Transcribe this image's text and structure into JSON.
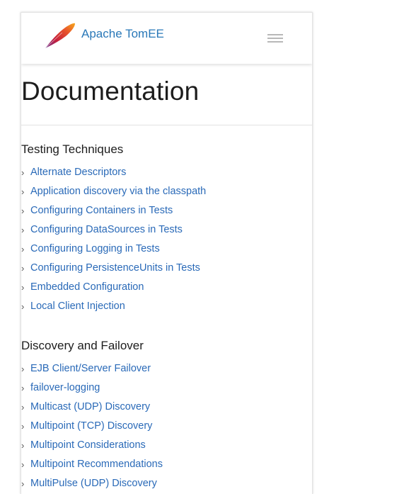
{
  "header": {
    "brand": "Apache TomEE",
    "menu_icon": "hamburger-menu-icon",
    "logo_icon": "apache-feather-logo-icon"
  },
  "page": {
    "title": "Documentation"
  },
  "sections": [
    {
      "heading": "Testing Techniques",
      "items": [
        "Alternate Descriptors",
        "Application discovery via the classpath",
        "Configuring Containers in Tests",
        "Configuring DataSources in Tests",
        "Configuring Logging in Tests",
        "Configuring PersistenceUnits in Tests",
        "Embedded Configuration",
        "Local Client Injection"
      ]
    },
    {
      "heading": "Discovery and Failover",
      "items": [
        "EJB Client/Server Failover",
        "failover-logging",
        "Multicast (UDP) Discovery",
        "Multipoint (TCP) Discovery",
        "Multipoint Considerations",
        "Multipoint Recommendations",
        "MultiPulse (UDP) Discovery"
      ]
    }
  ],
  "colors": {
    "link": "#2a6ab8",
    "brand": "#2a78b8",
    "chevron": "#555555"
  }
}
